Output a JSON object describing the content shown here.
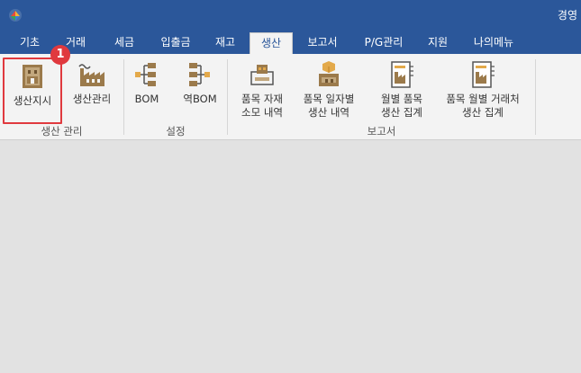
{
  "window": {
    "title": "경영",
    "logo_icon": "app-logo-icon"
  },
  "tabs": [
    {
      "label": "기초",
      "active": false
    },
    {
      "label": "거래",
      "active": false
    },
    {
      "label": "세금",
      "active": false
    },
    {
      "label": "입출금",
      "active": false
    },
    {
      "label": "재고",
      "active": false
    },
    {
      "label": "생산",
      "active": true
    },
    {
      "label": "보고서",
      "active": false
    },
    {
      "label": "P/G관리",
      "active": false
    },
    {
      "label": "지원",
      "active": false
    },
    {
      "label": "나의메뉴",
      "active": false
    }
  ],
  "ribbon": {
    "groups": [
      {
        "label": "생산 관리"
      },
      {
        "label": "설정"
      },
      {
        "label": "보고서"
      }
    ],
    "buttons": [
      {
        "label": "생산지시",
        "icon": "production-order-icon"
      },
      {
        "label": "생산관리",
        "icon": "factory-icon"
      },
      {
        "label": "BOM",
        "icon": "bom-tree-icon"
      },
      {
        "label": "역BOM",
        "icon": "reverse-bom-icon"
      },
      {
        "label_line1": "품목 자재",
        "label_line2": "소모 내역",
        "icon": "material-consumption-icon"
      },
      {
        "label_line1": "품목 일자별",
        "label_line2": "생산 내역",
        "icon": "daily-production-icon"
      },
      {
        "label_line1": "월별 품목",
        "label_line2": "생산 집계",
        "icon": "monthly-summary-icon"
      },
      {
        "label_line1": "품목 월별 거래처",
        "label_line2": "생산 집계",
        "icon": "monthly-client-summary-icon"
      }
    ]
  },
  "annotation": {
    "badge": "1"
  },
  "colors": {
    "brand_blue": "#2b579a",
    "icon_tan": "#9b7a4b",
    "icon_gold": "#e3a94a",
    "highlight_red": "#e0393e"
  }
}
